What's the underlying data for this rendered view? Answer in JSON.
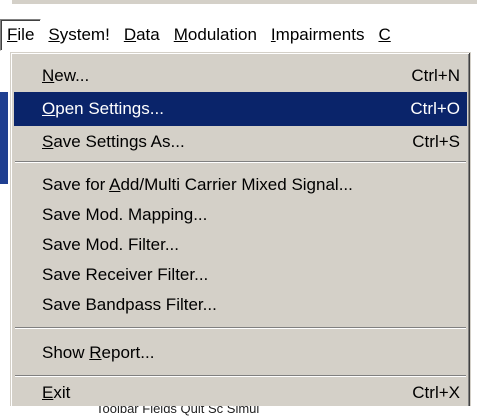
{
  "menubar": {
    "items": [
      {
        "pre": "",
        "key": "F",
        "post": "ile"
      },
      {
        "pre": "",
        "key": "S",
        "post": "ystem!"
      },
      {
        "pre": "",
        "key": "D",
        "post": "ata"
      },
      {
        "pre": "",
        "key": "M",
        "post": "odulation"
      },
      {
        "pre": "",
        "key": "I",
        "post": "mpairments"
      },
      {
        "pre": "",
        "key": "",
        "post": "C"
      }
    ]
  },
  "file_menu": {
    "items": [
      {
        "pre": "",
        "key": "N",
        "post": "ew...",
        "shortcut": "Ctrl+N"
      },
      {
        "pre": "",
        "key": "O",
        "post": "pen Settings...",
        "shortcut": "Ctrl+O"
      },
      {
        "pre": "",
        "key": "S",
        "post": "ave Settings As...",
        "shortcut": "Ctrl+S"
      },
      {
        "pre": "Save for ",
        "key": "A",
        "post": "dd/Multi Carrier Mixed Signal...",
        "shortcut": ""
      },
      {
        "pre": "Save Mod. Mapping...",
        "key": "",
        "post": "",
        "shortcut": ""
      },
      {
        "pre": "Save Mod. Filter...",
        "key": "",
        "post": "",
        "shortcut": ""
      },
      {
        "pre": "Save Receiver Filter...",
        "key": "",
        "post": "",
        "shortcut": ""
      },
      {
        "pre": "Save Bandpass Filter...",
        "key": "",
        "post": "",
        "shortcut": ""
      },
      {
        "pre": "Show ",
        "key": "R",
        "post": "eport...",
        "shortcut": ""
      },
      {
        "pre": "",
        "key": "E",
        "post": "xit",
        "shortcut": "Ctrl+X"
      }
    ],
    "highlighted_index": 1
  },
  "background": {
    "bottom_text": "Toolbar Fields Quit Sc Simul"
  },
  "colors": {
    "menu_bg": "#d4d0c8",
    "highlight_bg": "#0a246a",
    "highlight_fg": "#ffffff"
  }
}
